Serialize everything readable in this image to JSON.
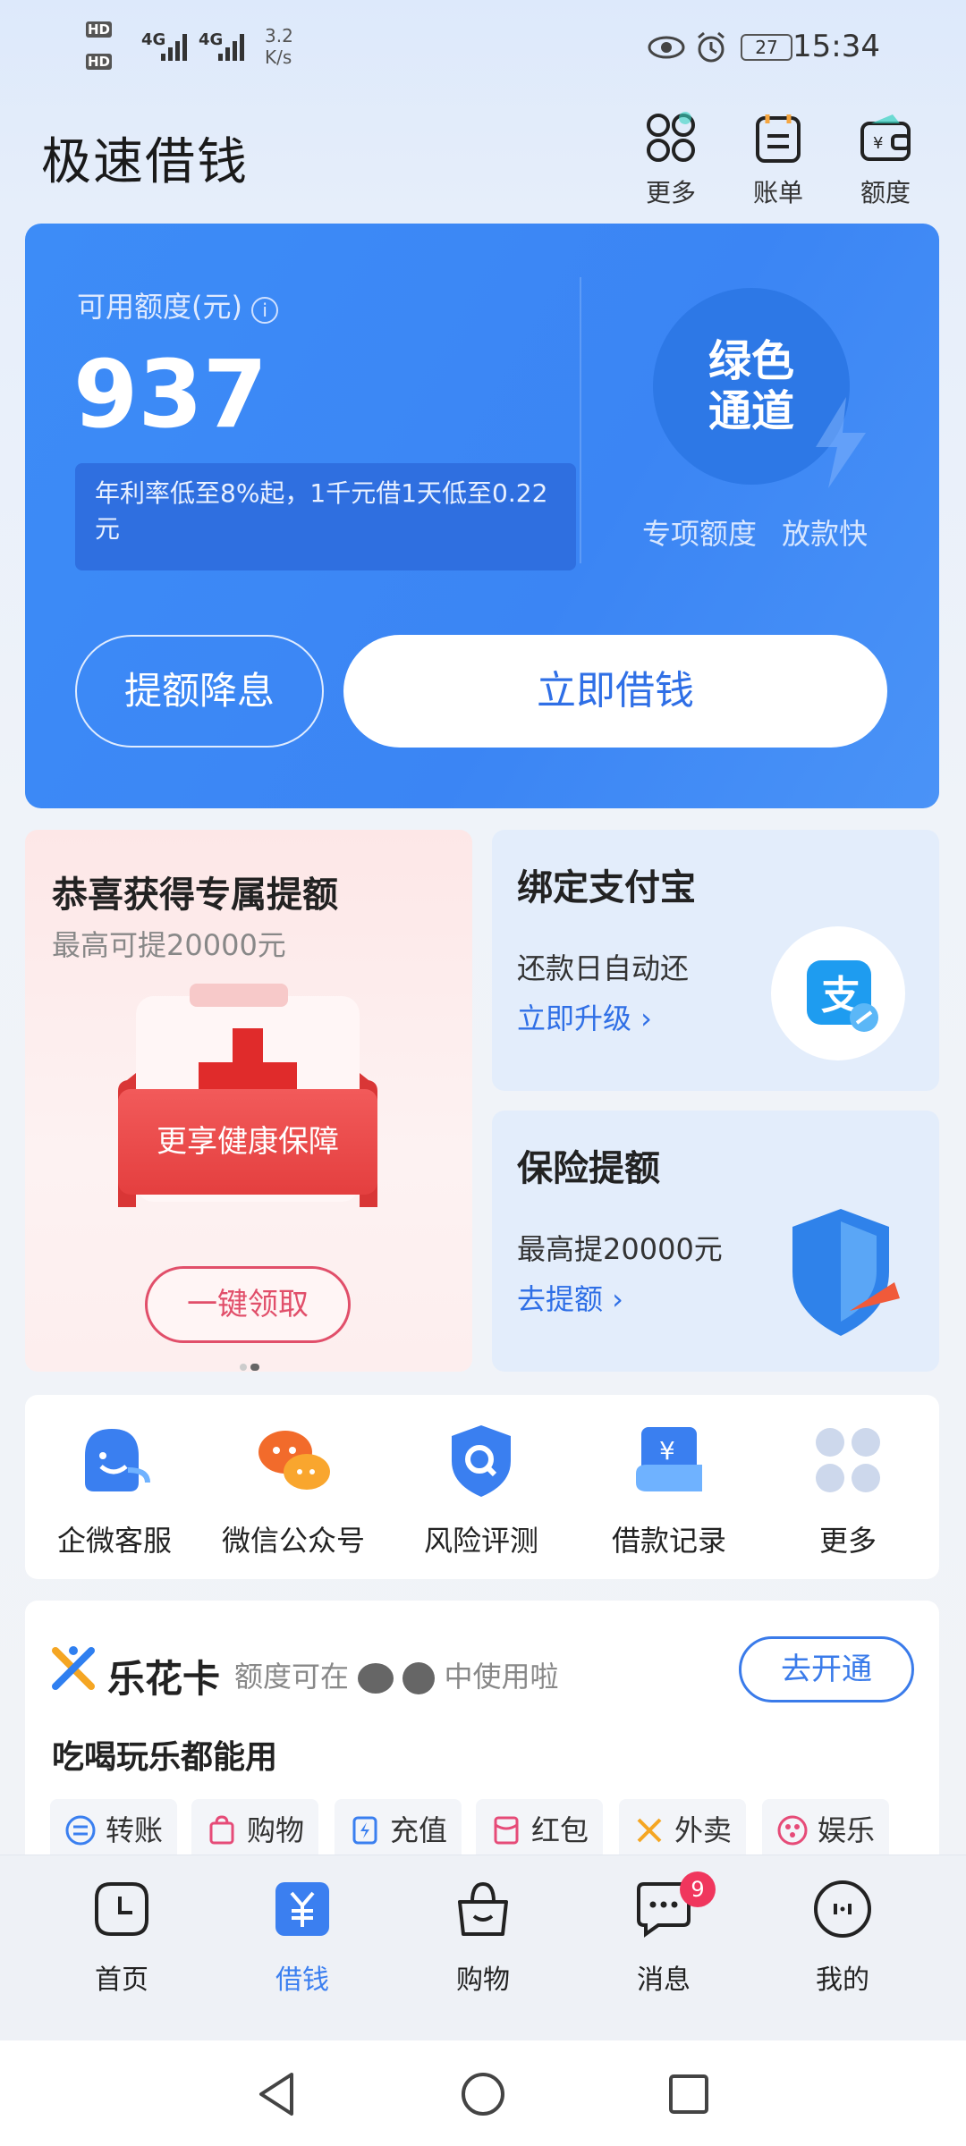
{
  "status": {
    "signal1": "HD",
    "signal2": "HD",
    "net1": "4G",
    "net2": "4G",
    "speed": "3.2",
    "speed_unit": "K/s",
    "battery": "27",
    "time": "15:34"
  },
  "header": {
    "title": "极速借钱",
    "actions": [
      "更多",
      "账单",
      "额度"
    ]
  },
  "credit": {
    "label": "可用额度(元)",
    "amount": "937",
    "rate_text": "年利率低至8%起，1千元借1天低至0.22元",
    "green_channel": "绿色通道",
    "features": "专项额度 放款快",
    "raise_button": "提额降息",
    "borrow_button": "立即借钱"
  },
  "promo_left": {
    "title": "恭喜获得专属提额",
    "subtitle": "最高可提20000元",
    "banner": "更享健康保障",
    "button": "一键领取"
  },
  "promo_alipay": {
    "title": "绑定支付宝",
    "line1": "还款日自动还",
    "link": "立即升级 ›"
  },
  "promo_insurance": {
    "title": "保险提额",
    "line1": "最高提20000元",
    "link": "去提额 ›"
  },
  "quick_links": [
    "企微客服",
    "微信公众号",
    "风险评测",
    "借款记录",
    "更多"
  ],
  "lehua": {
    "title": "乐花卡",
    "subtitle": "额度可在",
    "subtitle2": "中使用啦",
    "open_button": "去开通",
    "tagline": "吃喝玩乐都能用",
    "chips": [
      "转账",
      "购物",
      "充值",
      "红包",
      "外卖",
      "娱乐"
    ]
  },
  "nav": {
    "items": [
      "首页",
      "借钱",
      "购物",
      "消息",
      "我的"
    ],
    "active": "借钱",
    "message_badge": "9"
  },
  "colors": {
    "primary": "#3b85f4",
    "accent_red": "#e14f6a",
    "badge": "#f0365d"
  }
}
